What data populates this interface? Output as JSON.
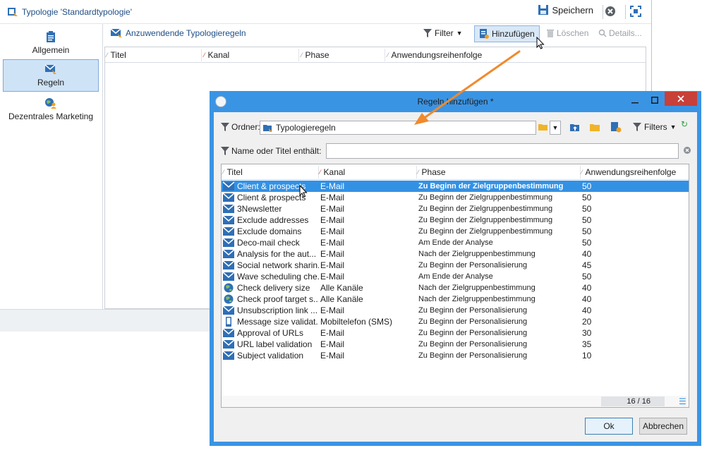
{
  "main_window": {
    "title": "Typologie 'Standardtypologie'",
    "save_label": "Speichern",
    "nav": [
      {
        "label": "Allgemein",
        "icon": "clipboard-icon"
      },
      {
        "label": "Regeln",
        "icon": "rule-envelope-icon",
        "selected": true
      },
      {
        "label": "Dezentrales Marketing",
        "icon": "globe-user-icon"
      }
    ],
    "rules_panel": {
      "title": "Anzuwendende Typologieregeln",
      "filter_label": "Filter",
      "add_label": "Hinzufügen",
      "delete_label": "Löschen",
      "details_label": "Details...",
      "columns": [
        "Titel",
        "Kanal",
        "Phase",
        "Anwendungsreihenfolge"
      ]
    }
  },
  "dialog": {
    "title": "Regeln hinzufügen *",
    "ordner_label": "Ordner:",
    "ordner_value": "Typologieregeln",
    "filters_label": "Filters",
    "name_label": "Name oder Titel enthält:",
    "name_value": "",
    "columns": [
      "Titel",
      "Kanal",
      "Phase",
      "Anwendungsreihenfolge"
    ],
    "rows": [
      {
        "icon": "email-icon",
        "title": "Client & prospects",
        "channel": "E-Mail",
        "phase": "Zu Beginn der Zielgruppenbestimmung",
        "order": "50",
        "selected": true
      },
      {
        "icon": "email-icon",
        "title": "Client & prospects",
        "channel": "E-Mail",
        "phase": "Zu Beginn der Zielgruppenbestimmung",
        "order": "50"
      },
      {
        "icon": "email-icon",
        "title": "3Newsletter",
        "channel": "E-Mail",
        "phase": "Zu Beginn der Zielgruppenbestimmung",
        "order": "50"
      },
      {
        "icon": "email-icon",
        "title": "Exclude addresses",
        "channel": "E-Mail",
        "phase": "Zu Beginn der Zielgruppenbestimmung",
        "order": "50"
      },
      {
        "icon": "email-icon",
        "title": "Exclude domains",
        "channel": "E-Mail",
        "phase": "Zu Beginn der Zielgruppenbestimmung",
        "order": "50"
      },
      {
        "icon": "email-icon",
        "title": "Deco-mail check",
        "channel": "E-Mail",
        "phase": "Am Ende der Analyse",
        "order": "50"
      },
      {
        "icon": "email-icon",
        "title": "Analysis for the aut...",
        "channel": "E-Mail",
        "phase": "Nach der Zielgruppenbestimmung",
        "order": "40"
      },
      {
        "icon": "email-icon",
        "title": "Social network sharin...",
        "channel": "E-Mail",
        "phase": "Zu Beginn der Personalisierung",
        "order": "45"
      },
      {
        "icon": "email-icon",
        "title": "Wave scheduling che...",
        "channel": "E-Mail",
        "phase": "Am Ende der Analyse",
        "order": "50"
      },
      {
        "icon": "globe-icon",
        "title": "Check delivery size",
        "channel": "Alle Kanäle",
        "phase": "Nach der Zielgruppenbestimmung",
        "order": "40"
      },
      {
        "icon": "globe-icon",
        "title": "Check proof target s...",
        "channel": "Alle Kanäle",
        "phase": "Nach der Zielgruppenbestimmung",
        "order": "40"
      },
      {
        "icon": "email-icon",
        "title": "Unsubscription link ...",
        "channel": "E-Mail",
        "phase": "Zu Beginn der Personalisierung",
        "order": "40"
      },
      {
        "icon": "mobile-icon",
        "title": "Message size validat...",
        "channel": "Mobiltelefon (SMS)",
        "phase": "Zu Beginn der Personalisierung",
        "order": "20"
      },
      {
        "icon": "email-icon",
        "title": "Approval of URLs",
        "channel": "E-Mail",
        "phase": "Zu Beginn der Personalisierung",
        "order": "30"
      },
      {
        "icon": "email-icon",
        "title": "URL label validation",
        "channel": "E-Mail",
        "phase": "Zu Beginn der Personalisierung",
        "order": "35"
      },
      {
        "icon": "email-icon",
        "title": "Subject validation",
        "channel": "E-Mail",
        "phase": "Zu Beginn der Personalisierung",
        "order": "10"
      }
    ],
    "count_label": "16 / 16",
    "ok_label": "Ok",
    "cancel_label": "Abbrechen"
  },
  "colors": {
    "selection": "#3391e4",
    "dialog_frame": "#3a94e4",
    "close_button": "#c7403a",
    "annotation_arrow": "#f08a2c",
    "link_blue": "#1f4f86"
  }
}
